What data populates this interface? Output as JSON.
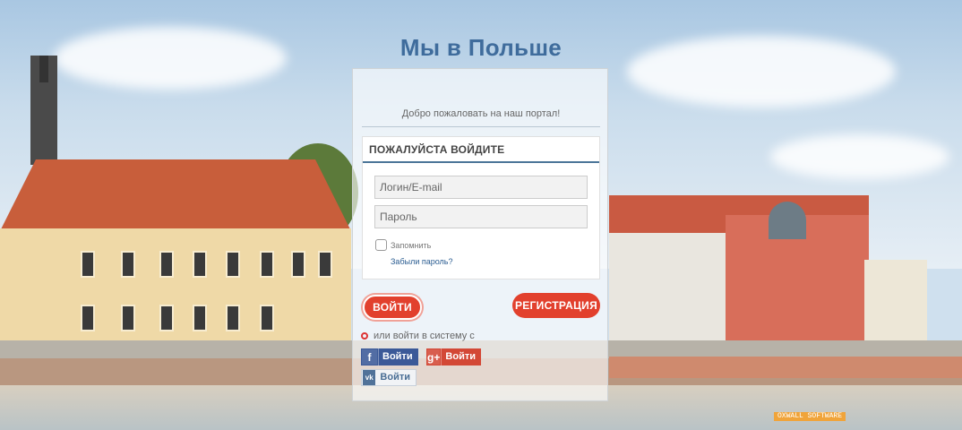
{
  "site": {
    "title": "Мы в Польше"
  },
  "panel": {
    "welcome": "Добро пожаловать на наш портал!",
    "heading": "ПОЖАЛУЙСТА ВОЙДИТЕ",
    "login_placeholder": "Логин/E-mail",
    "password_placeholder": "Пароль",
    "remember_label": "Запомнить",
    "forgot_link": "Забыли пароль?",
    "login_button": "ВОЙТИ",
    "register_button": "РЕГИСТРАЦИЯ",
    "or_text": "или войти в систему с"
  },
  "social": {
    "facebook": {
      "icon": "f",
      "label": "Войти"
    },
    "google": {
      "icon": "g+",
      "label": "Войти"
    },
    "vk": {
      "icon": "vk",
      "label": "Войти"
    }
  },
  "watermark": "OXWALL SOFTWARE",
  "colors": {
    "accent_red": "#e2402d",
    "title_blue": "#3f6c9c",
    "facebook": "#3b5998",
    "google": "#d34836",
    "vk": "#507299"
  }
}
